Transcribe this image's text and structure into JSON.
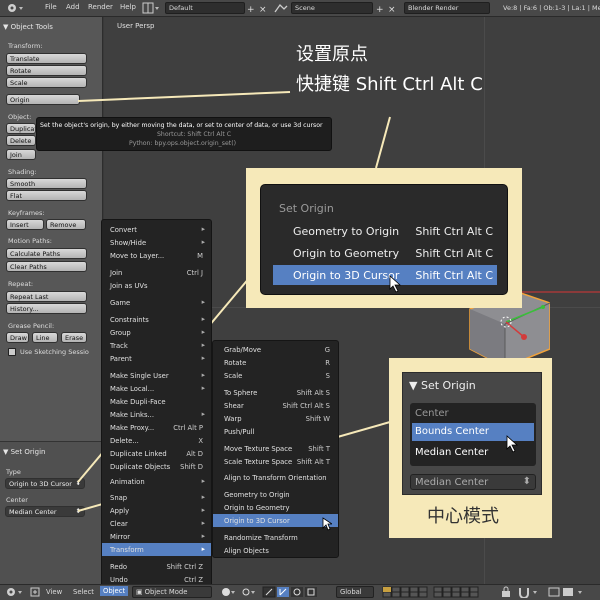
{
  "top_bar": {
    "menus": [
      "File",
      "Add",
      "Render",
      "Help"
    ],
    "screen_layout": "Default",
    "scene": "Scene",
    "render_engine": "Blender Render",
    "stats": "Ve:8 | Fa:6 | Ob:1-3 | La:1 | Mem:5"
  },
  "tool_shelf": {
    "header": "Object Tools",
    "transform": {
      "label": "Transform:",
      "buttons": [
        "Translate",
        "Rotate",
        "Scale"
      ]
    },
    "origin_button": "Origin",
    "object": {
      "label": "Object:",
      "buttons": [
        "Duplicate",
        "Delete",
        "Join"
      ]
    },
    "shading": {
      "label": "Shading:",
      "buttons": [
        "Smooth",
        "Flat"
      ]
    },
    "keyframes": {
      "label": "Keyframes:",
      "buttons": [
        "Insert",
        "Remove"
      ]
    },
    "motion_paths": {
      "label": "Motion Paths:",
      "buttons": [
        "Calculate Paths",
        "Clear Paths"
      ]
    },
    "repeat": {
      "label": "Repeat:",
      "buttons": [
        "Repeat Last",
        "History..."
      ]
    },
    "grease_pencil": {
      "label": "Grease Pencil:",
      "buttons": [
        "Draw",
        "Line",
        "Erase"
      ],
      "checkbox": "Use Sketching Sessio"
    }
  },
  "operator_panel": {
    "title": "Set Origin",
    "type_label": "Type",
    "type_value": "Origin to 3D Cursor",
    "center_label": "Center",
    "center_value": "Median Center"
  },
  "viewport": {
    "view_label": "User Persp"
  },
  "tooltip": {
    "description": "Set the object's origin, by either moving the data, or set to center of data, or use 3d cursor",
    "shortcut": "Shortcut: Shift Ctrl Alt C",
    "python": "Python: bpy.ops.object.origin_set()"
  },
  "callouts": {
    "title_line1": "设置原点",
    "title_line2": "快捷键 Shift Ctrl Alt C",
    "center_caption": "中心模式"
  },
  "set_origin_popup": {
    "title": "Set Origin",
    "items": [
      {
        "label": "Geometry to Origin",
        "shortcut": "Shift Ctrl Alt C"
      },
      {
        "label": "Origin to Geometry",
        "shortcut": "Shift Ctrl Alt C"
      },
      {
        "label": "Origin to 3D Cursor",
        "shortcut": "Shift Ctrl Alt C"
      }
    ]
  },
  "center_popup": {
    "title": "Set Origin",
    "list_title": "Center",
    "options": [
      "Bounds Center",
      "Median Center"
    ],
    "selected": "Median Center"
  },
  "object_menu": [
    {
      "label": "Convert"
    },
    {
      "label": "Show/Hide"
    },
    {
      "label": "Move to Layer...",
      "shortcut": "M"
    },
    {
      "label": "Join",
      "shortcut": "Ctrl J"
    },
    {
      "label": "Join as UVs"
    },
    {
      "label": "Game"
    },
    {
      "label": "Constraints"
    },
    {
      "label": "Group"
    },
    {
      "label": "Track"
    },
    {
      "label": "Parent"
    },
    {
      "label": "Make Single User"
    },
    {
      "label": "Make Local..."
    },
    {
      "label": "Make Dupli-Face"
    },
    {
      "label": "Make Links..."
    },
    {
      "label": "Make Proxy...",
      "shortcut": "Ctrl Alt P"
    },
    {
      "label": "Delete...",
      "shortcut": "X"
    },
    {
      "label": "Duplicate Linked",
      "shortcut": "Alt D"
    },
    {
      "label": "Duplicate Objects",
      "shortcut": "Shift D"
    },
    {
      "label": "Animation"
    },
    {
      "label": "Snap"
    },
    {
      "label": "Apply"
    },
    {
      "label": "Clear"
    },
    {
      "label": "Mirror"
    },
    {
      "label": "Transform"
    },
    {
      "label": "Redo",
      "shortcut": "Shift Ctrl Z"
    },
    {
      "label": "Undo",
      "shortcut": "Ctrl Z"
    }
  ],
  "transform_menu": [
    {
      "label": "Grab/Move",
      "shortcut": "G"
    },
    {
      "label": "Rotate",
      "shortcut": "R"
    },
    {
      "label": "Scale",
      "shortcut": "S"
    },
    {
      "label": "To Sphere",
      "shortcut": "Shift Alt S"
    },
    {
      "label": "Shear",
      "shortcut": "Shift Ctrl Alt S"
    },
    {
      "label": "Warp",
      "shortcut": "Shift W"
    },
    {
      "label": "Push/Pull"
    },
    {
      "label": "Move Texture Space",
      "shortcut": "Shift T"
    },
    {
      "label": "Scale Texture Space",
      "shortcut": "Shift Alt T"
    },
    {
      "label": "Align to Transform Orientation"
    },
    {
      "label": "Geometry to Origin"
    },
    {
      "label": "Origin to Geometry"
    },
    {
      "label": "Origin to 3D Cursor"
    },
    {
      "label": "Randomize Transform"
    },
    {
      "label": "Align Objects"
    }
  ],
  "bottom_bar": {
    "menus": [
      "View",
      "Select",
      "Object"
    ],
    "mode": "Object Mode",
    "orientation": "Global"
  },
  "colors": {
    "highlight": "#5680c2",
    "callout_background": "#f6e9b9",
    "selection_outline": "#f2a33a"
  }
}
